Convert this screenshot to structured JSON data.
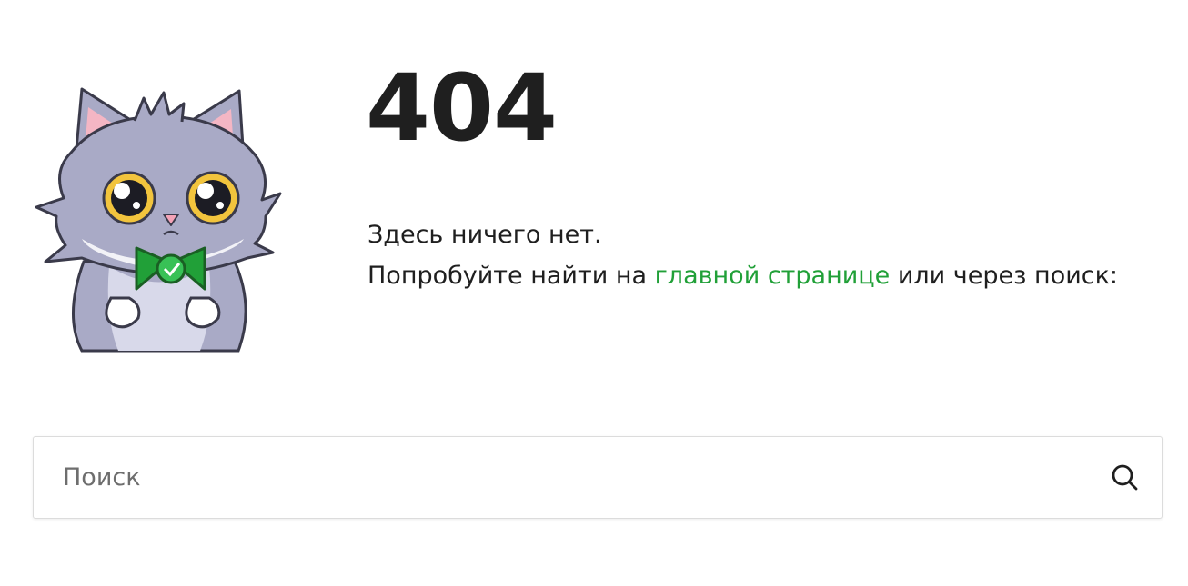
{
  "error": {
    "code": "404"
  },
  "message": {
    "line1": "Здесь ничего нет.",
    "line2_before": "Попробуйте найти на ",
    "link_label": "главной странице",
    "line2_after": " или через поиск:"
  },
  "search": {
    "placeholder": "Поиск",
    "value": "",
    "icon": "search-icon"
  },
  "illustration": {
    "icon": "sad-cat-mascot"
  },
  "colors": {
    "link": "#21a038",
    "text": "#1f1f1f",
    "placeholder": "#6e6e6e"
  }
}
